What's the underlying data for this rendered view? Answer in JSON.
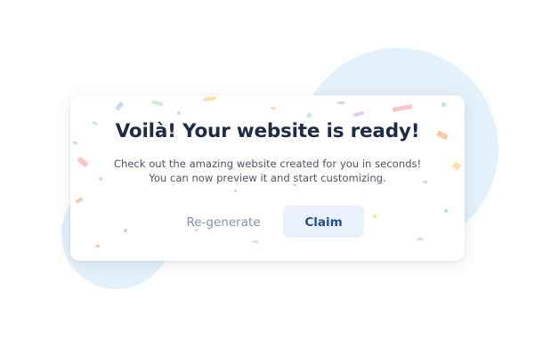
{
  "dialog": {
    "title": "Voilà! Your website is ready!",
    "message_line1": "Check out the amazing website created for you in seconds!",
    "message_line2": "You can now preview it and start customizing.",
    "regenerate_label": "Re-generate",
    "claim_label": "Claim"
  },
  "colors": {
    "background_blob": "#e5f1fa",
    "title": "#1f2a44",
    "body_text": "#4d5566",
    "secondary_button_text": "#8391a8",
    "primary_button_bg": "#eaf1fd",
    "primary_button_text": "#1f4f8f",
    "confetti": [
      "#f7c6c6",
      "#c9d8f5",
      "#fbe3a8",
      "#c8ecd1",
      "#f6c9a8",
      "#e0cdf5",
      "#b9e3ef"
    ]
  }
}
